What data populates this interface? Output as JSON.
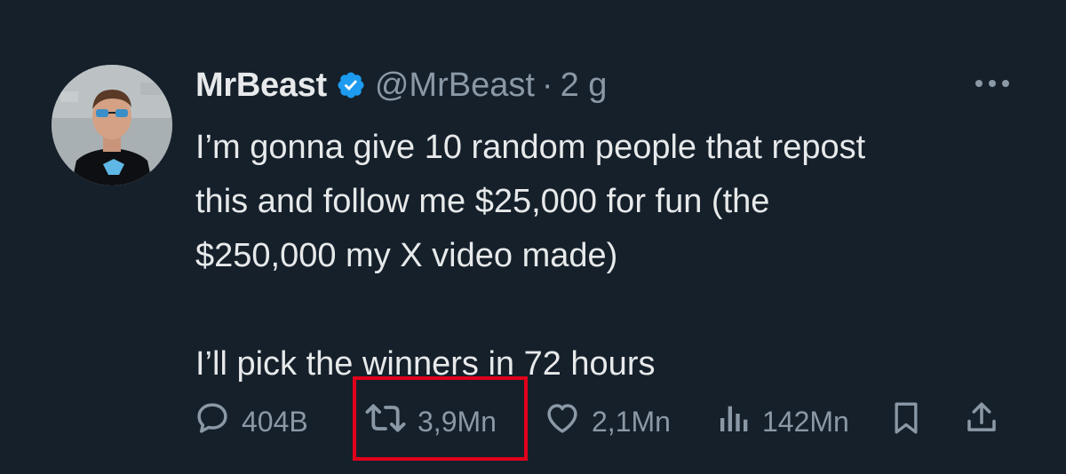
{
  "tweet": {
    "author_name": "MrBeast",
    "handle": "@MrBeast",
    "separator": "·",
    "time": "2 g",
    "text_lines": [
      "I’m gonna give 10 random people that repost",
      "this and follow me $25,000 for fun (the",
      "$250,000 my X video made)",
      "I’ll pick the winners in 72 hours"
    ],
    "icons": {
      "verified": "verified-badge-icon",
      "more": "more-options-icon",
      "reply": "reply-icon",
      "repost": "repost-icon",
      "like": "heart-icon",
      "views": "views-chart-icon",
      "bookmark": "bookmark-icon",
      "share": "share-icon"
    }
  },
  "actions": {
    "replies": "404B",
    "reposts": "3,9Mn",
    "likes": "2,1Mn",
    "views": "142Mn"
  },
  "colors": {
    "background": "#15202b",
    "text": "#e7e9ea",
    "secondary": "#8b98a5",
    "verified": "#1d9bf0",
    "highlight_box": "#e0001b"
  }
}
